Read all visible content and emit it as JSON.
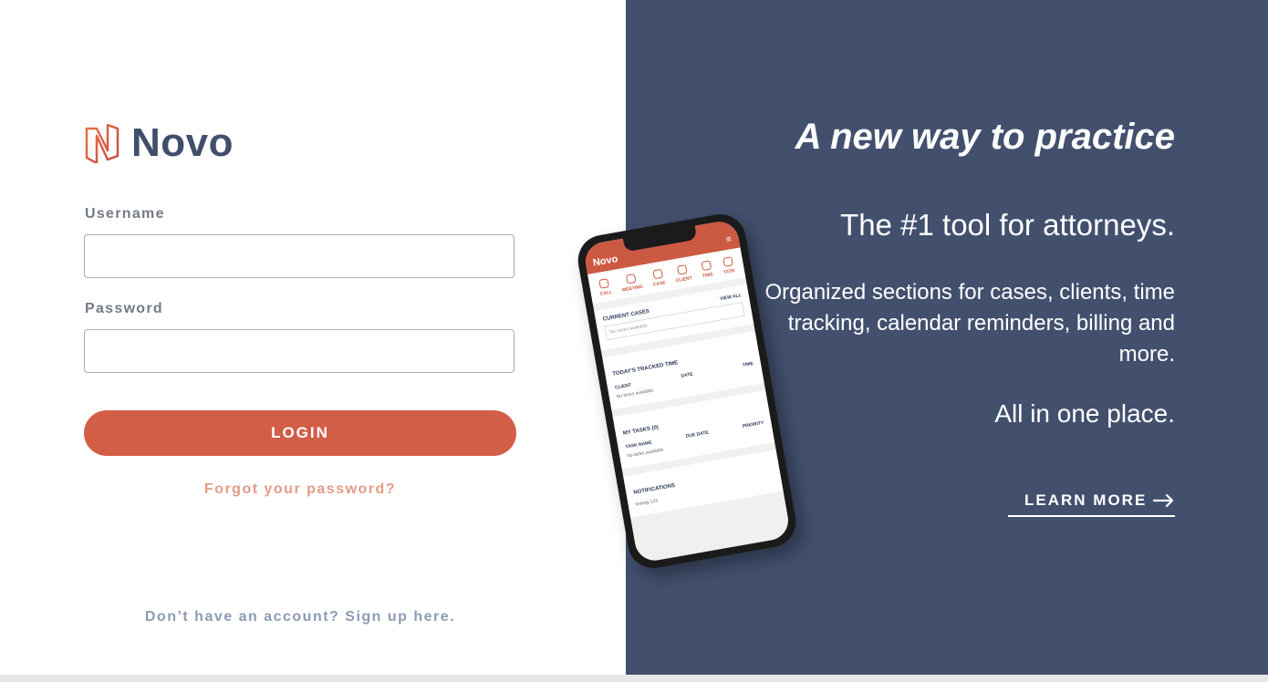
{
  "brand": {
    "name": "Novo"
  },
  "form": {
    "username_label": "Username",
    "username_value": "",
    "password_label": "Password",
    "password_value": "",
    "login_label": "LOGIN",
    "forgot_label": "Forgot your password?",
    "signup_label": "Don’t have an account? Sign up here."
  },
  "promo": {
    "headline": "A new way to practice",
    "subhead": "The #1 tool for attorneys.",
    "description": "Organized sections for cases, clients, time tracking, calendar reminders, billing and more.",
    "tagline": "All in one place.",
    "learn_more": "LEARN MORE"
  },
  "phone": {
    "brand": "Novo",
    "menu_icon": "hamburger-icon",
    "icons": [
      {
        "label": "CALL",
        "icon": "phone-icon"
      },
      {
        "label": "MEETING",
        "icon": "chat-icon"
      },
      {
        "label": "CASE",
        "icon": "scales-icon"
      },
      {
        "label": "CLIENT",
        "icon": "person-icon"
      },
      {
        "label": "TIME",
        "icon": "clock-icon"
      },
      {
        "label": "TASK",
        "icon": "clipboard-icon"
      }
    ],
    "current_cases": {
      "title": "CURRENT CASES",
      "link": "VIEW ALL",
      "empty": "No cases available."
    },
    "tracked_time": {
      "title": "TODAY'S TRACKED TIME",
      "columns": [
        "CLIENT",
        "DATE",
        "TIME"
      ],
      "empty": "No times available."
    },
    "tasks": {
      "title": "MY TASKS (0)",
      "columns": [
        "TASK NAME",
        "DUE DATE",
        "PRIORITY"
      ],
      "empty": "No tasks available."
    },
    "notifications": {
      "title": "NOTIFICATIONS",
      "item": "testing 123"
    }
  },
  "colors": {
    "accent": "#d35e48",
    "panel": "#42506e",
    "brand_text": "#414f6b"
  }
}
